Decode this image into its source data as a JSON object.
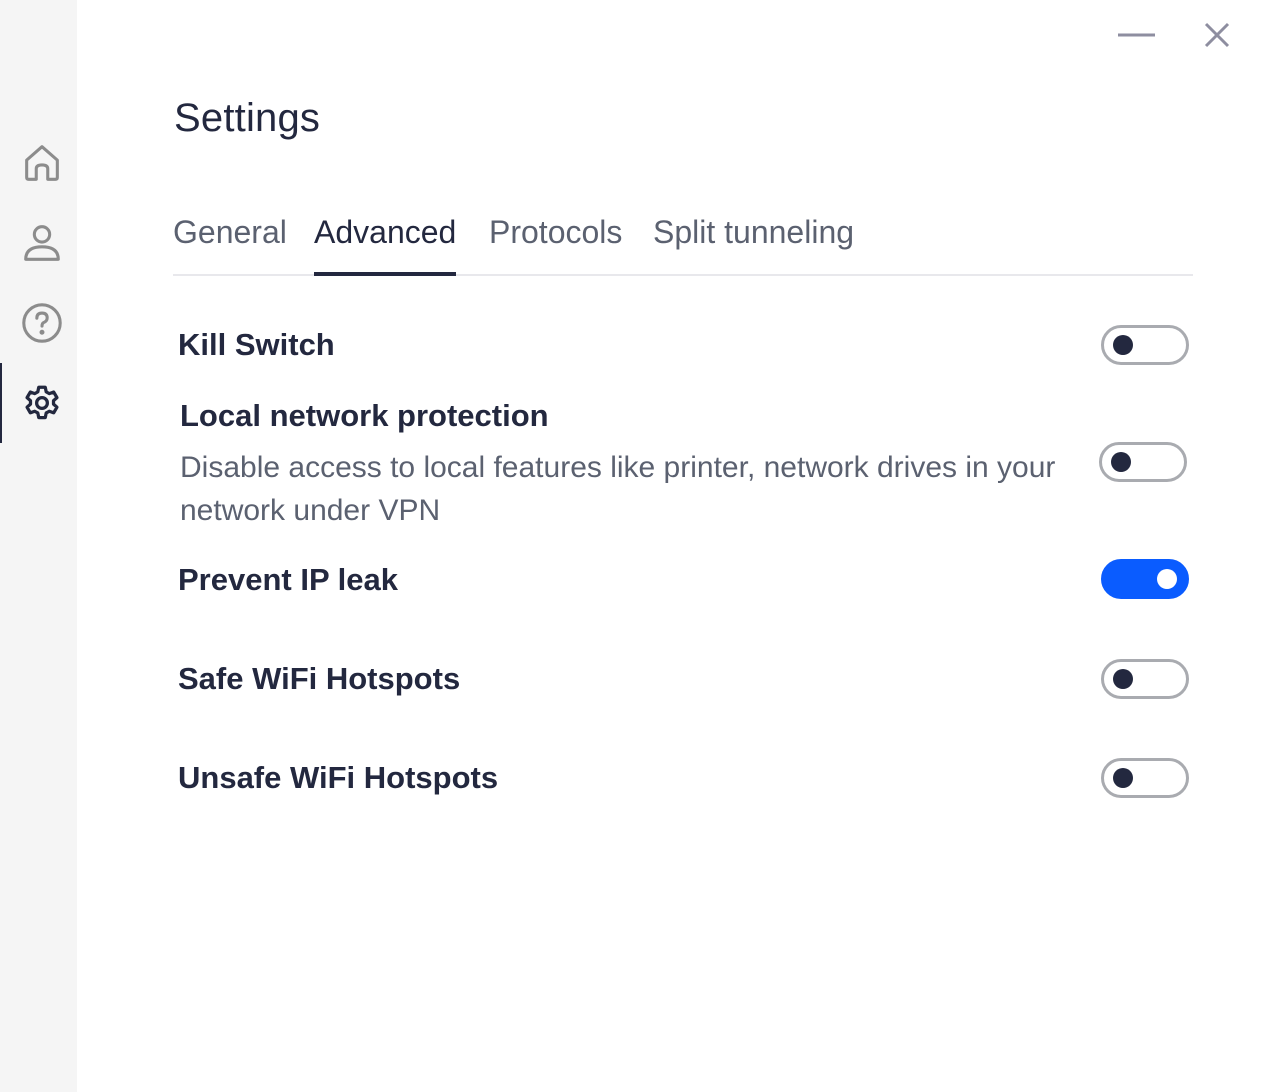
{
  "window": {
    "minimize_icon": "minimize-icon",
    "close_icon": "close-icon"
  },
  "sidebar": {
    "items": [
      {
        "name": "home",
        "icon": "home-icon",
        "active": false
      },
      {
        "name": "account",
        "icon": "user-icon",
        "active": false
      },
      {
        "name": "help",
        "icon": "help-icon",
        "active": false
      },
      {
        "name": "settings",
        "icon": "gear-icon",
        "active": true
      }
    ]
  },
  "header": {
    "title": "Settings"
  },
  "tabs": [
    {
      "label": "General",
      "active": false
    },
    {
      "label": "Advanced",
      "active": true
    },
    {
      "label": "Protocols",
      "active": false
    },
    {
      "label": "Split tunneling",
      "active": false
    }
  ],
  "settings": [
    {
      "label": "Kill Switch",
      "description": "",
      "enabled": false
    },
    {
      "label": "Local network protection",
      "description": "Disable access to local features like printer, network drives in your network under VPN",
      "enabled": false
    },
    {
      "label": "Prevent IP leak",
      "description": "",
      "enabled": true
    },
    {
      "label": "Safe WiFi Hotspots",
      "description": "",
      "enabled": false
    },
    {
      "label": "Unsafe WiFi Hotspots",
      "description": "",
      "enabled": false
    }
  ],
  "colors": {
    "accent": "#0a5cff",
    "text_primary": "#23283f",
    "text_secondary": "#5b6170",
    "sidebar_bg": "#f5f5f5"
  }
}
